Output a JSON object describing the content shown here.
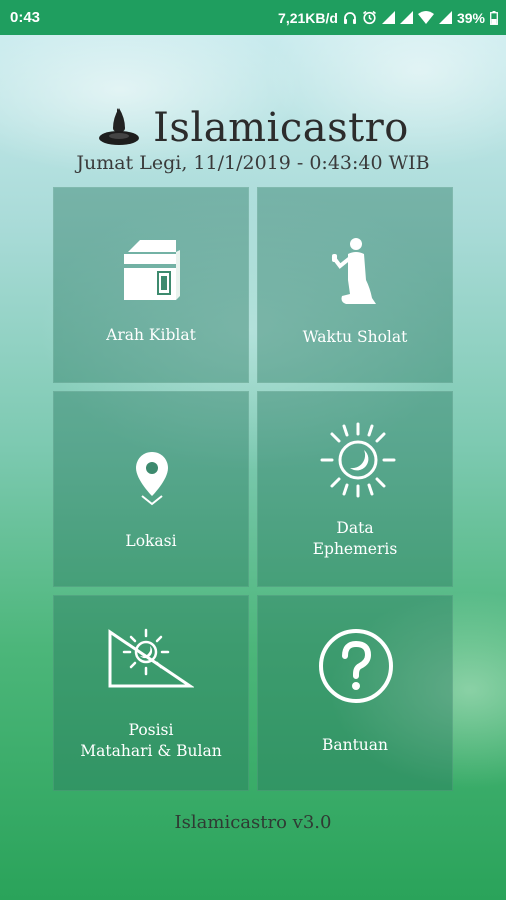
{
  "status_bar": {
    "time": "0:43",
    "net_speed": "7,21KB/d",
    "battery": "39%"
  },
  "app": {
    "title": "Islamicastro",
    "datetime": "Jumat Legi, 11/1/2019 - 0:43:40 WIB",
    "version": "Islamicastro v3.0"
  },
  "menu": {
    "arah_kiblat": "Arah Kiblat",
    "waktu_sholat": "Waktu Sholat",
    "lokasi": "Lokasi",
    "data_ephemeris_line1": "Data",
    "data_ephemeris_line2": "Ephemeris",
    "posisi_line1": "Posisi",
    "posisi_line2": "Matahari & Bulan",
    "bantuan": "Bantuan"
  },
  "colors": {
    "status_bar": "#1f9e5f",
    "tile": "#28785f"
  }
}
